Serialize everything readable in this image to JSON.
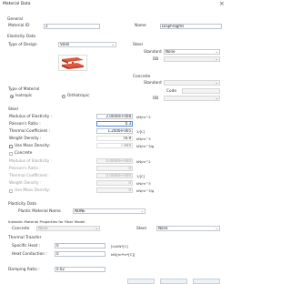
{
  "window": {
    "title": "Material Data",
    "close": "×"
  },
  "general": {
    "title": "General",
    "material_id_label": "Material ID",
    "material_id_value": "2",
    "name_label": "Name",
    "name_value": "Diaphragms"
  },
  "elasticity": {
    "title": "Elasticity Data",
    "type_of_design_label": "Type of Design",
    "type_of_design_value": "Steel",
    "steel": {
      "title": "Steel",
      "standard_label": "Standard",
      "standard_value": "None",
      "db_label": "DB"
    },
    "concrete": {
      "title": "Concrete",
      "standard_label": "Standard",
      "code_label": "Code",
      "db_label": "DB"
    },
    "type_of_material": {
      "title": "Type of Material",
      "isotropic": "Isotropic",
      "orthotropic": "Orthotropic",
      "selected": "Isotropic"
    }
  },
  "steel_props": {
    "title": "Steel",
    "rows": [
      {
        "label": "Modulus of Elasticity :",
        "value": "2.0000e+008",
        "unit": "kN/m^2"
      },
      {
        "label": "Poisson's Ratio :",
        "value": "0.3",
        "unit": ""
      },
      {
        "label": "Thermal Coefficient :",
        "value": "1.2000e-005",
        "unit": "1/[C]"
      },
      {
        "label": "Weight Density :",
        "value": "76.9",
        "unit": "kN/m^3"
      }
    ],
    "use_mass_density_label": "Use Mass Density:",
    "mass_density_value": "7.849",
    "mass_density_unit": "kN/m^3/g"
  },
  "concrete_props": {
    "title": "Concrete",
    "rows": [
      {
        "label": "Modulus of Elasticity :",
        "value": "0.0000e+000",
        "unit": "kN/m^2"
      },
      {
        "label": "Poisson's Ratio :",
        "value": "0",
        "unit": ""
      },
      {
        "label": "Thermal Coefficient :",
        "value": "0.0000e+000",
        "unit": "1/[C]"
      },
      {
        "label": "Weight Density :",
        "value": "0",
        "unit": "kN/m^3"
      }
    ],
    "use_mass_density_label": "Use Mass Density:",
    "mass_density_value": "0",
    "mass_density_unit": "kN/m^3/g"
  },
  "plasticity": {
    "title": "Plasticity Data",
    "plastic_material_name_label": "Plastic Material Name",
    "plastic_material_name_value": "NONE"
  },
  "inelastic": {
    "title": "Inelastic Material Properties for Fiber Model",
    "concrete_label": "Concrete",
    "concrete_value": "None",
    "steel_label": "Steel",
    "steel_value": "None"
  },
  "thermal": {
    "title": "Thermal Transfer",
    "rows": [
      {
        "label": "Specific Heat :",
        "value": "0",
        "unit": "[in/kN*[C]"
      },
      {
        "label": "Heat Conduction :",
        "value": "0",
        "unit": "kN/[m*hr*[C]]"
      }
    ]
  },
  "damping": {
    "label": "Damping Ratio :",
    "value": "0.02"
  }
}
